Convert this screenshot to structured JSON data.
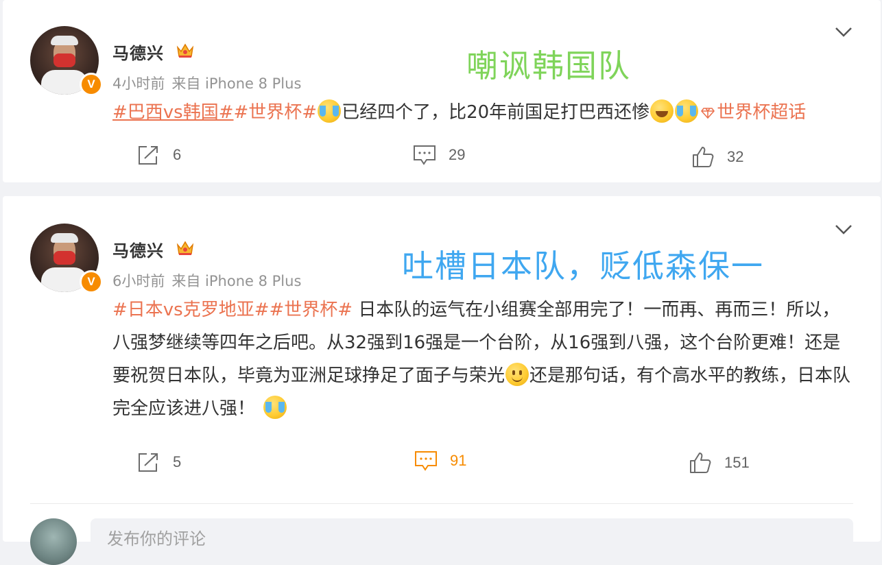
{
  "posts": [
    {
      "author": "马德兴",
      "time": "4小时前",
      "source": "来自 iPhone 8 Plus",
      "annotation": "嘲讽韩国队",
      "topics": [
        "#巴西vs韩国#",
        "#世界杯#"
      ],
      "text_a": "已经四个了，比20年前国足打巴西还惨",
      "super_topic": "世界杯超话",
      "reposts": "6",
      "comments": "29",
      "likes": "32"
    },
    {
      "author": "马德兴",
      "time": "6小时前",
      "source": "来自 iPhone 8 Plus",
      "annotation": "吐槽日本队，贬低森保一",
      "topics": [
        "#日本vs克罗地亚#",
        "#世界杯#"
      ],
      "text_a": " 日本队的运气在小组赛全部用完了！一而再、再而三！所以，八强梦继续等四年之后吧。从32强到16强是一个台阶，从16强到八强，这个台阶更难！还是要祝贺日本队，毕竟为亚洲足球挣足了面子与荣光",
      "text_b": "还是那句话，有个高水平的教练，日本队完全应该进八强！",
      "reposts": "5",
      "comments": "91",
      "likes": "151"
    }
  ],
  "comment_box": {
    "placeholder": "发布你的评论"
  },
  "icons": {
    "verified_badge": "v-badge-icon",
    "vip": "crown-icon",
    "menu": "chevron-down-icon",
    "repost": "repost-icon",
    "comment": "comment-icon",
    "like": "thumbs-up-icon",
    "emoji_cry": "laugh-cry-emoji-icon",
    "emoji_laugh": "grin-sweat-emoji-icon",
    "emoji_smile": "smile-emoji-icon",
    "super_topic": "diamond-icon"
  },
  "colors": {
    "accent": "#f78b00",
    "topic": "#eb7350",
    "annot1": "#7fd45a",
    "annot2": "#3fa7f0"
  }
}
